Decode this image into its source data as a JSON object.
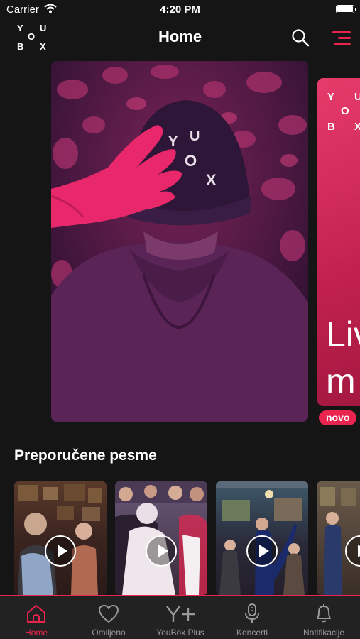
{
  "status_bar": {
    "carrier": "Carrier",
    "time": "4:20 PM"
  },
  "header": {
    "title": "Home",
    "logo_letters": [
      "Y",
      "O",
      "U",
      "B",
      "O",
      "X"
    ]
  },
  "featured": {
    "cap_letters": [
      "Y",
      "O",
      "U",
      "O",
      "X"
    ],
    "second_card": {
      "logo_letters": [
        "Y",
        "O",
        "U",
        "B",
        "O",
        "X"
      ],
      "text_lines": [
        "Liv",
        "m"
      ],
      "badge": "novo"
    }
  },
  "section": {
    "title": "Preporučene pesme"
  },
  "tabbar": {
    "tabs": [
      {
        "label": "Home",
        "icon": "home-icon",
        "active": true
      },
      {
        "label": "Omiljeno",
        "icon": "heart-icon",
        "active": false
      },
      {
        "label": "YouBox Plus",
        "icon": "youbox-plus-icon",
        "active": false
      },
      {
        "label": "Koncerti",
        "icon": "microphone-icon",
        "active": false
      },
      {
        "label": "Notifikacije",
        "icon": "bell-icon",
        "active": false
      }
    ]
  },
  "colors": {
    "accent": "#e8244f",
    "background": "#151515",
    "tabbar": "#222222"
  }
}
